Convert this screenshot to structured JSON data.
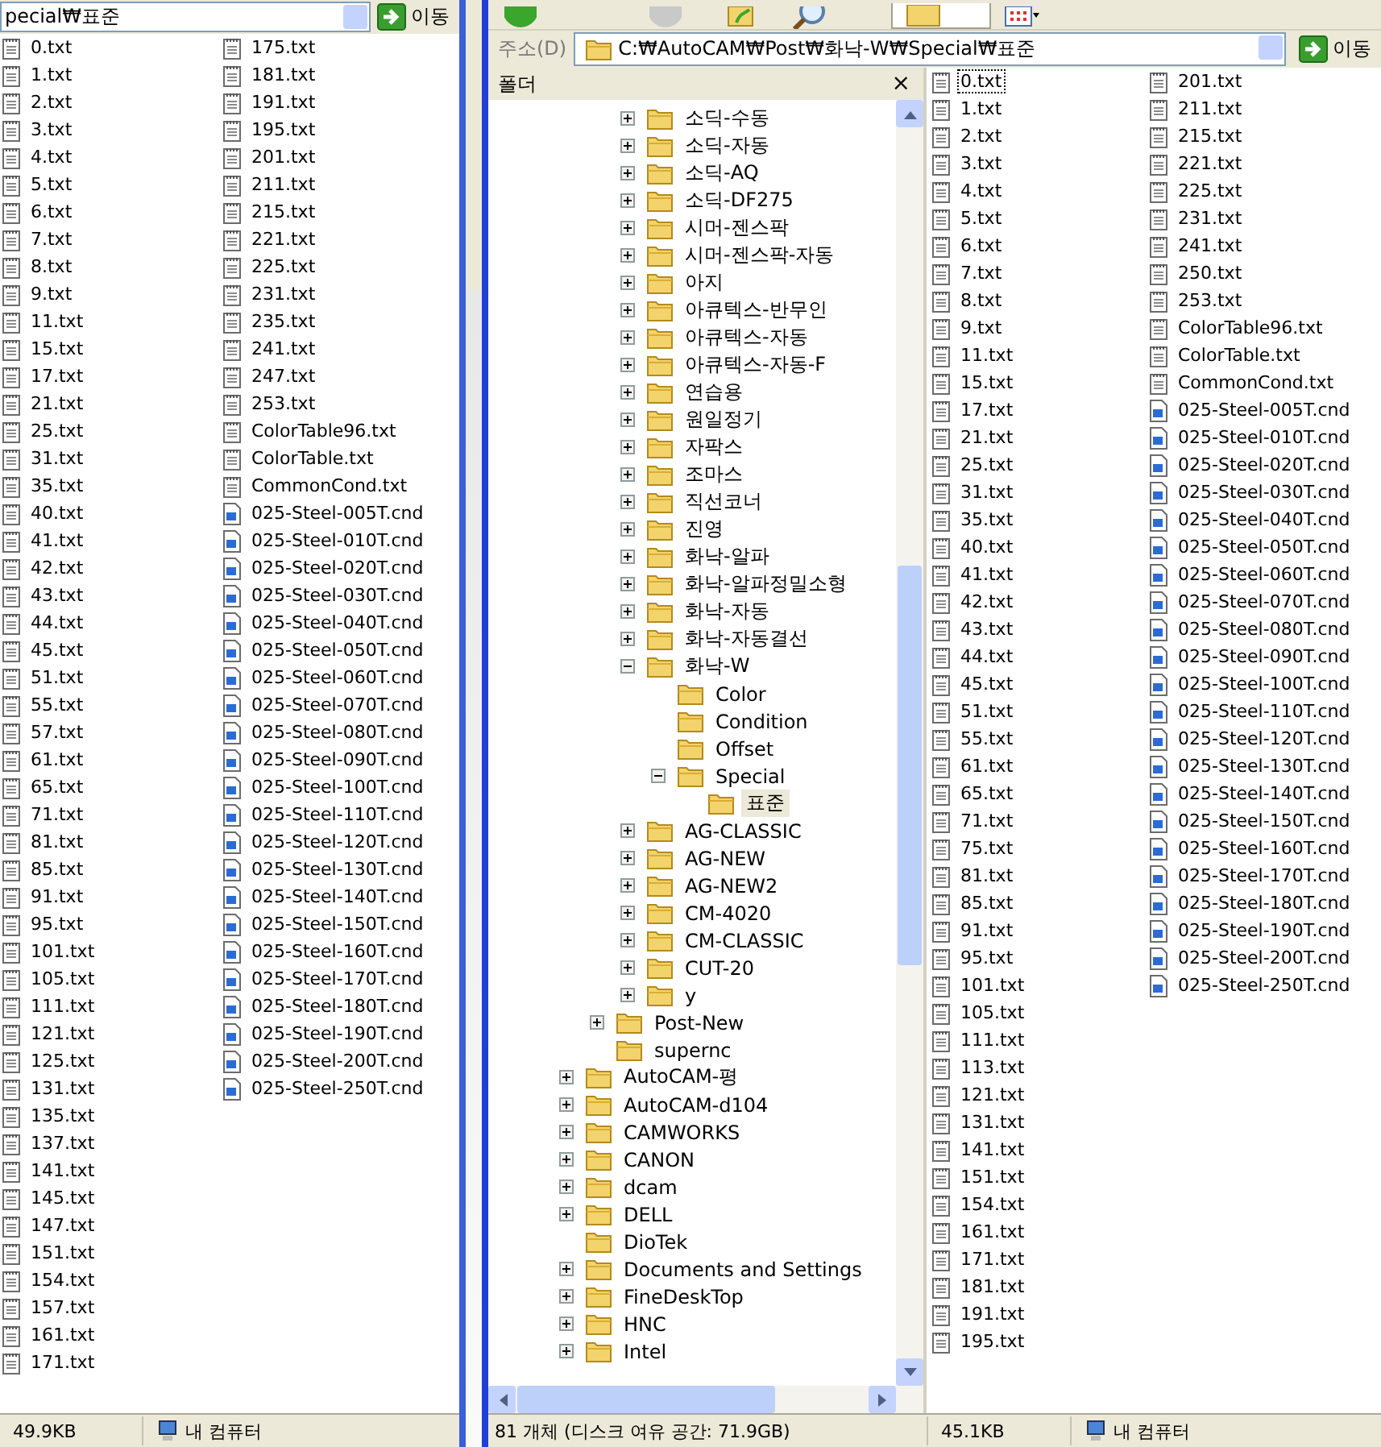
{
  "left_window": {
    "address": {
      "value": "pecial₩표준",
      "go_button": "이동"
    },
    "files": {
      "columns": [
        [
          {
            "name": "0.txt",
            "kind": "txt"
          },
          {
            "name": "1.txt",
            "kind": "txt"
          },
          {
            "name": "2.txt",
            "kind": "txt"
          },
          {
            "name": "3.txt",
            "kind": "txt"
          },
          {
            "name": "4.txt",
            "kind": "txt"
          },
          {
            "name": "5.txt",
            "kind": "txt"
          },
          {
            "name": "6.txt",
            "kind": "txt"
          },
          {
            "name": "7.txt",
            "kind": "txt"
          },
          {
            "name": "8.txt",
            "kind": "txt"
          },
          {
            "name": "9.txt",
            "kind": "txt"
          },
          {
            "name": "11.txt",
            "kind": "txt"
          },
          {
            "name": "15.txt",
            "kind": "txt"
          },
          {
            "name": "17.txt",
            "kind": "txt"
          },
          {
            "name": "21.txt",
            "kind": "txt"
          },
          {
            "name": "25.txt",
            "kind": "txt"
          },
          {
            "name": "31.txt",
            "kind": "txt"
          },
          {
            "name": "35.txt",
            "kind": "txt"
          },
          {
            "name": "40.txt",
            "kind": "txt"
          },
          {
            "name": "41.txt",
            "kind": "txt"
          },
          {
            "name": "42.txt",
            "kind": "txt"
          },
          {
            "name": "43.txt",
            "kind": "txt"
          },
          {
            "name": "44.txt",
            "kind": "txt"
          },
          {
            "name": "45.txt",
            "kind": "txt"
          },
          {
            "name": "51.txt",
            "kind": "txt"
          },
          {
            "name": "55.txt",
            "kind": "txt"
          },
          {
            "name": "57.txt",
            "kind": "txt"
          },
          {
            "name": "61.txt",
            "kind": "txt"
          },
          {
            "name": "65.txt",
            "kind": "txt"
          },
          {
            "name": "71.txt",
            "kind": "txt"
          },
          {
            "name": "81.txt",
            "kind": "txt"
          },
          {
            "name": "85.txt",
            "kind": "txt"
          },
          {
            "name": "91.txt",
            "kind": "txt"
          },
          {
            "name": "95.txt",
            "kind": "txt"
          },
          {
            "name": "101.txt",
            "kind": "txt"
          },
          {
            "name": "105.txt",
            "kind": "txt"
          },
          {
            "name": "111.txt",
            "kind": "txt"
          },
          {
            "name": "121.txt",
            "kind": "txt"
          },
          {
            "name": "125.txt",
            "kind": "txt"
          },
          {
            "name": "131.txt",
            "kind": "txt"
          },
          {
            "name": "135.txt",
            "kind": "txt"
          },
          {
            "name": "137.txt",
            "kind": "txt"
          },
          {
            "name": "141.txt",
            "kind": "txt"
          },
          {
            "name": "145.txt",
            "kind": "txt"
          },
          {
            "name": "147.txt",
            "kind": "txt"
          },
          {
            "name": "151.txt",
            "kind": "txt"
          },
          {
            "name": "154.txt",
            "kind": "txt"
          },
          {
            "name": "157.txt",
            "kind": "txt"
          },
          {
            "name": "161.txt",
            "kind": "txt"
          },
          {
            "name": "171.txt",
            "kind": "txt"
          }
        ],
        [
          {
            "name": "175.txt",
            "kind": "txt"
          },
          {
            "name": "181.txt",
            "kind": "txt"
          },
          {
            "name": "191.txt",
            "kind": "txt"
          },
          {
            "name": "195.txt",
            "kind": "txt"
          },
          {
            "name": "201.txt",
            "kind": "txt"
          },
          {
            "name": "211.txt",
            "kind": "txt"
          },
          {
            "name": "215.txt",
            "kind": "txt"
          },
          {
            "name": "221.txt",
            "kind": "txt"
          },
          {
            "name": "225.txt",
            "kind": "txt"
          },
          {
            "name": "231.txt",
            "kind": "txt"
          },
          {
            "name": "235.txt",
            "kind": "txt"
          },
          {
            "name": "241.txt",
            "kind": "txt"
          },
          {
            "name": "247.txt",
            "kind": "txt"
          },
          {
            "name": "253.txt",
            "kind": "txt"
          },
          {
            "name": "ColorTable96.txt",
            "kind": "txt"
          },
          {
            "name": "ColorTable.txt",
            "kind": "txt"
          },
          {
            "name": "CommonCond.txt",
            "kind": "txt"
          },
          {
            "name": "025-Steel-005T.cnd",
            "kind": "cnd"
          },
          {
            "name": "025-Steel-010T.cnd",
            "kind": "cnd"
          },
          {
            "name": "025-Steel-020T.cnd",
            "kind": "cnd"
          },
          {
            "name": "025-Steel-030T.cnd",
            "kind": "cnd"
          },
          {
            "name": "025-Steel-040T.cnd",
            "kind": "cnd"
          },
          {
            "name": "025-Steel-050T.cnd",
            "kind": "cnd"
          },
          {
            "name": "025-Steel-060T.cnd",
            "kind": "cnd"
          },
          {
            "name": "025-Steel-070T.cnd",
            "kind": "cnd"
          },
          {
            "name": "025-Steel-080T.cnd",
            "kind": "cnd"
          },
          {
            "name": "025-Steel-090T.cnd",
            "kind": "cnd"
          },
          {
            "name": "025-Steel-100T.cnd",
            "kind": "cnd"
          },
          {
            "name": "025-Steel-110T.cnd",
            "kind": "cnd"
          },
          {
            "name": "025-Steel-120T.cnd",
            "kind": "cnd"
          },
          {
            "name": "025-Steel-130T.cnd",
            "kind": "cnd"
          },
          {
            "name": "025-Steel-140T.cnd",
            "kind": "cnd"
          },
          {
            "name": "025-Steel-150T.cnd",
            "kind": "cnd"
          },
          {
            "name": "025-Steel-160T.cnd",
            "kind": "cnd"
          },
          {
            "name": "025-Steel-170T.cnd",
            "kind": "cnd"
          },
          {
            "name": "025-Steel-180T.cnd",
            "kind": "cnd"
          },
          {
            "name": "025-Steel-190T.cnd",
            "kind": "cnd"
          },
          {
            "name": "025-Steel-200T.cnd",
            "kind": "cnd"
          },
          {
            "name": "025-Steel-250T.cnd",
            "kind": "cnd"
          }
        ]
      ]
    },
    "status_bar": {
      "size": "49.9KB",
      "zone": "내 컴퓨터"
    }
  },
  "right_window": {
    "address": {
      "label": "주소(D)",
      "value": "C:₩AutoCAM₩Post₩화낙-W₩Special₩표준",
      "go_button": "이동"
    },
    "folder_pane": {
      "title": "폴더",
      "close": "×"
    },
    "tree": {
      "items": [
        {
          "children": [
            {
              "children": [
                {
                  "label": "소딕-수동",
                  "expanded": false,
                  "selected": false
                },
                {
                  "label": "소딕-자동",
                  "expanded": false,
                  "selected": false
                },
                {
                  "label": "소딕-AQ",
                  "expanded": false,
                  "selected": false
                },
                {
                  "label": "소딕-DF275",
                  "expanded": false,
                  "selected": false
                },
                {
                  "label": "시머-젠스팍",
                  "expanded": false,
                  "selected": false
                },
                {
                  "label": "시머-젠스팍-자동",
                  "expanded": false,
                  "selected": false
                },
                {
                  "label": "아지",
                  "expanded": false,
                  "selected": false
                },
                {
                  "label": "아큐텍스-반무인",
                  "expanded": false,
                  "selected": false
                },
                {
                  "label": "아큐텍스-자동",
                  "expanded": false,
                  "selected": false
                },
                {
                  "label": "아큐텍스-자동-F",
                  "expanded": false,
                  "selected": false
                },
                {
                  "label": "연습용",
                  "expanded": false,
                  "selected": false
                },
                {
                  "label": "원일정기",
                  "expanded": false,
                  "selected": false
                },
                {
                  "label": "자팍스",
                  "expanded": false,
                  "selected": false
                },
                {
                  "label": "조마스",
                  "expanded": false,
                  "selected": false
                },
                {
                  "label": "직선코너",
                  "expanded": false,
                  "selected": false
                },
                {
                  "label": "진영",
                  "expanded": false,
                  "selected": false
                },
                {
                  "label": "화낙-알파",
                  "expanded": false,
                  "selected": false
                },
                {
                  "label": "화낙-알파정밀소형",
                  "expanded": false,
                  "selected": false
                },
                {
                  "label": "화낙-자동",
                  "expanded": false,
                  "selected": false
                },
                {
                  "label": "화낙-자동결선",
                  "expanded": false,
                  "selected": false
                },
                {
                  "label": "화낙-W",
                  "expanded": true,
                  "selected": false,
                  "children": [
                    {
                      "label": "Color",
                      "selected": false
                    },
                    {
                      "label": "Condition",
                      "selected": false
                    },
                    {
                      "label": "Offset",
                      "selected": false
                    },
                    {
                      "label": "Special",
                      "expanded": true,
                      "selected": false,
                      "children": [
                        {
                          "label": "표준",
                          "selected": true
                        }
                      ]
                    }
                  ]
                },
                {
                  "label": "AG-CLASSIC",
                  "expanded": false,
                  "selected": false
                },
                {
                  "label": "AG-NEW",
                  "expanded": false,
                  "selected": false
                },
                {
                  "label": "AG-NEW2",
                  "expanded": false,
                  "selected": false
                },
                {
                  "label": "CM-4020",
                  "expanded": false,
                  "selected": false
                },
                {
                  "label": "CM-CLASSIC",
                  "expanded": false,
                  "selected": false
                },
                {
                  "label": "CUT-20",
                  "expanded": false,
                  "selected": false
                },
                {
                  "label": "y",
                  "expanded": false,
                  "selected": false
                }
              ]
            },
            {
              "label": "Post-New",
              "expanded": false,
              "selected": false
            },
            {
              "label": "supernc",
              "selected": false
            }
          ]
        },
        {
          "label": "AutoCAM-평",
          "expanded": false,
          "selected": false
        },
        {
          "label": "AutoCAM-d104",
          "expanded": false,
          "selected": false
        },
        {
          "label": "CAMWORKS",
          "expanded": false,
          "selected": false
        },
        {
          "label": "CANON",
          "expanded": false,
          "selected": false
        },
        {
          "label": "dcam",
          "expanded": false,
          "selected": false
        },
        {
          "label": "DELL",
          "expanded": false,
          "selected": false
        },
        {
          "label": "DioTek",
          "selected": false
        },
        {
          "label": "Documents and Settings",
          "expanded": false,
          "selected": false
        },
        {
          "label": "FineDeskTop",
          "expanded": false,
          "selected": false
        },
        {
          "label": "HNC",
          "expanded": false,
          "selected": false
        },
        {
          "label": "Intel",
          "expanded": false,
          "selected": false
        }
      ]
    },
    "files": {
      "columns": [
        [
          {
            "name": "0.txt",
            "kind": "txt",
            "selected": true
          },
          {
            "name": "1.txt",
            "kind": "txt",
            "selected": false
          },
          {
            "name": "2.txt",
            "kind": "txt",
            "selected": false
          },
          {
            "name": "3.txt",
            "kind": "txt",
            "selected": false
          },
          {
            "name": "4.txt",
            "kind": "txt",
            "selected": false
          },
          {
            "name": "5.txt",
            "kind": "txt",
            "selected": false
          },
          {
            "name": "6.txt",
            "kind": "txt",
            "selected": false
          },
          {
            "name": "7.txt",
            "kind": "txt",
            "selected": false
          },
          {
            "name": "8.txt",
            "kind": "txt",
            "selected": false
          },
          {
            "name": "9.txt",
            "kind": "txt",
            "selected": false
          },
          {
            "name": "11.txt",
            "kind": "txt",
            "selected": false
          },
          {
            "name": "15.txt",
            "kind": "txt",
            "selected": false
          },
          {
            "name": "17.txt",
            "kind": "txt",
            "selected": false
          },
          {
            "name": "21.txt",
            "kind": "txt",
            "selected": false
          },
          {
            "name": "25.txt",
            "kind": "txt",
            "selected": false
          },
          {
            "name": "31.txt",
            "kind": "txt",
            "selected": false
          },
          {
            "name": "35.txt",
            "kind": "txt",
            "selected": false
          },
          {
            "name": "40.txt",
            "kind": "txt",
            "selected": false
          },
          {
            "name": "41.txt",
            "kind": "txt",
            "selected": false
          },
          {
            "name": "42.txt",
            "kind": "txt",
            "selected": false
          },
          {
            "name": "43.txt",
            "kind": "txt",
            "selected": false
          },
          {
            "name": "44.txt",
            "kind": "txt",
            "selected": false
          },
          {
            "name": "45.txt",
            "kind": "txt",
            "selected": false
          },
          {
            "name": "51.txt",
            "kind": "txt",
            "selected": false
          },
          {
            "name": "55.txt",
            "kind": "txt",
            "selected": false
          },
          {
            "name": "61.txt",
            "kind": "txt",
            "selected": false
          },
          {
            "name": "65.txt",
            "kind": "txt",
            "selected": false
          },
          {
            "name": "71.txt",
            "kind": "txt",
            "selected": false
          },
          {
            "name": "75.txt",
            "kind": "txt",
            "selected": false
          },
          {
            "name": "81.txt",
            "kind": "txt",
            "selected": false
          },
          {
            "name": "85.txt",
            "kind": "txt",
            "selected": false
          },
          {
            "name": "91.txt",
            "kind": "txt",
            "selected": false
          },
          {
            "name": "95.txt",
            "kind": "txt",
            "selected": false
          },
          {
            "name": "101.txt",
            "kind": "txt",
            "selected": false
          },
          {
            "name": "105.txt",
            "kind": "txt",
            "selected": false
          },
          {
            "name": "111.txt",
            "kind": "txt",
            "selected": false
          },
          {
            "name": "113.txt",
            "kind": "txt",
            "selected": false
          },
          {
            "name": "121.txt",
            "kind": "txt",
            "selected": false
          },
          {
            "name": "131.txt",
            "kind": "txt",
            "selected": false
          },
          {
            "name": "141.txt",
            "kind": "txt",
            "selected": false
          },
          {
            "name": "151.txt",
            "kind": "txt",
            "selected": false
          },
          {
            "name": "154.txt",
            "kind": "txt",
            "selected": false
          },
          {
            "name": "161.txt",
            "kind": "txt",
            "selected": false
          },
          {
            "name": "171.txt",
            "kind": "txt",
            "selected": false
          },
          {
            "name": "181.txt",
            "kind": "txt",
            "selected": false
          },
          {
            "name": "191.txt",
            "kind": "txt",
            "selected": false
          },
          {
            "name": "195.txt",
            "kind": "txt",
            "selected": false
          }
        ],
        [
          {
            "name": "201.txt",
            "kind": "txt",
            "selected": false
          },
          {
            "name": "211.txt",
            "kind": "txt",
            "selected": false
          },
          {
            "name": "215.txt",
            "kind": "txt",
            "selected": false
          },
          {
            "name": "221.txt",
            "kind": "txt",
            "selected": false
          },
          {
            "name": "225.txt",
            "kind": "txt",
            "selected": false
          },
          {
            "name": "231.txt",
            "kind": "txt",
            "selected": false
          },
          {
            "name": "241.txt",
            "kind": "txt",
            "selected": false
          },
          {
            "name": "250.txt",
            "kind": "txt",
            "selected": false
          },
          {
            "name": "253.txt",
            "kind": "txt",
            "selected": false
          },
          {
            "name": "ColorTable96.txt",
            "kind": "txt",
            "selected": false
          },
          {
            "name": "ColorTable.txt",
            "kind": "txt",
            "selected": false
          },
          {
            "name": "CommonCond.txt",
            "kind": "txt",
            "selected": false
          },
          {
            "name": "025-Steel-005T.cnd",
            "kind": "cnd",
            "selected": false
          },
          {
            "name": "025-Steel-010T.cnd",
            "kind": "cnd",
            "selected": false
          },
          {
            "name": "025-Steel-020T.cnd",
            "kind": "cnd",
            "selected": false
          },
          {
            "name": "025-Steel-030T.cnd",
            "kind": "cnd",
            "selected": false
          },
          {
            "name": "025-Steel-040T.cnd",
            "kind": "cnd",
            "selected": false
          },
          {
            "name": "025-Steel-050T.cnd",
            "kind": "cnd",
            "selected": false
          },
          {
            "name": "025-Steel-060T.cnd",
            "kind": "cnd",
            "selected": false
          },
          {
            "name": "025-Steel-070T.cnd",
            "kind": "cnd",
            "selected": false
          },
          {
            "name": "025-Steel-080T.cnd",
            "kind": "cnd",
            "selected": false
          },
          {
            "name": "025-Steel-090T.cnd",
            "kind": "cnd",
            "selected": false
          },
          {
            "name": "025-Steel-100T.cnd",
            "kind": "cnd",
            "selected": false
          },
          {
            "name": "025-Steel-110T.cnd",
            "kind": "cnd",
            "selected": false
          },
          {
            "name": "025-Steel-120T.cnd",
            "kind": "cnd",
            "selected": false
          },
          {
            "name": "025-Steel-130T.cnd",
            "kind": "cnd",
            "selected": false
          },
          {
            "name": "025-Steel-140T.cnd",
            "kind": "cnd",
            "selected": false
          },
          {
            "name": "025-Steel-150T.cnd",
            "kind": "cnd",
            "selected": false
          },
          {
            "name": "025-Steel-160T.cnd",
            "kind": "cnd",
            "selected": false
          },
          {
            "name": "025-Steel-170T.cnd",
            "kind": "cnd",
            "selected": false
          },
          {
            "name": "025-Steel-180T.cnd",
            "kind": "cnd",
            "selected": false
          },
          {
            "name": "025-Steel-190T.cnd",
            "kind": "cnd",
            "selected": false
          },
          {
            "name": "025-Steel-200T.cnd",
            "kind": "cnd",
            "selected": false
          },
          {
            "name": "025-Steel-250T.cnd",
            "kind": "cnd",
            "selected": false
          }
        ]
      ]
    },
    "status_bar": {
      "objects": "81 개체 (디스크 여유 공간: 71.9GB)",
      "size": "45.1KB",
      "zone": "내 컴퓨터"
    }
  }
}
